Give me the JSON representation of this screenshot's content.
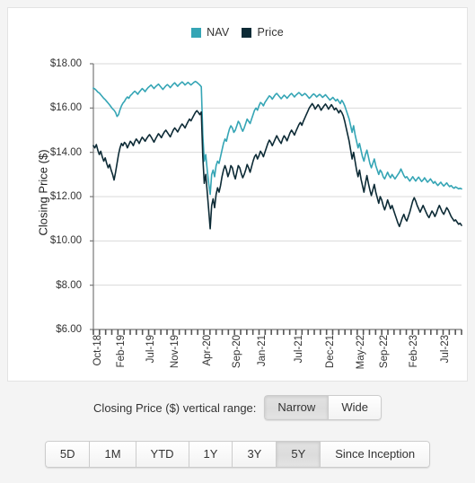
{
  "legend": {
    "entries": [
      {
        "label": "NAV",
        "color": "#35a5b5"
      },
      {
        "label": "Price",
        "color": "#0d2b36"
      }
    ]
  },
  "axes": {
    "y_title": "Closing Price ($)",
    "y_ticks": [
      "$18.00",
      "$16.00",
      "$14.00",
      "$12.00",
      "$10.00",
      "$8.00",
      "$6.00"
    ],
    "x_ticks": [
      "Oct-18",
      "Feb-19",
      "Jul-19",
      "Nov-19",
      "Apr-20",
      "Sep-20",
      "Jan-21",
      "Jul-21",
      "Dec-21",
      "May-22",
      "Sep-22",
      "Feb-23",
      "Jul-23"
    ]
  },
  "vertical_range": {
    "label": "Closing Price ($) vertical range:",
    "options": [
      {
        "label": "Narrow",
        "selected": true
      },
      {
        "label": "Wide",
        "selected": false
      }
    ]
  },
  "time_range": {
    "options": [
      {
        "label": "5D",
        "selected": false
      },
      {
        "label": "1M",
        "selected": false
      },
      {
        "label": "YTD",
        "selected": false
      },
      {
        "label": "1Y",
        "selected": false
      },
      {
        "label": "3Y",
        "selected": false
      },
      {
        "label": "5Y",
        "selected": true
      },
      {
        "label": "Since Inception",
        "selected": false
      }
    ]
  },
  "chart_data": {
    "type": "line",
    "title": "",
    "xlabel": "",
    "ylabel": "Closing Price ($)",
    "ylim": [
      6.0,
      18.0
    ],
    "ytick_values": [
      18.0,
      16.0,
      14.0,
      12.0,
      10.0,
      8.0,
      6.0
    ],
    "grid": true,
    "legend_position": "top-center",
    "x_tick_labels": [
      "Oct-18",
      "Feb-19",
      "Jul-19",
      "Nov-19",
      "Apr-20",
      "Sep-20",
      "Jan-21",
      "Jul-21",
      "Dec-21",
      "May-22",
      "Sep-22",
      "Feb-23",
      "Jul-23"
    ],
    "x_tick_indices": [
      0,
      16,
      36,
      52,
      74,
      94,
      111,
      136,
      157,
      178,
      194,
      214,
      235
    ],
    "x_range_labels": [
      "Oct-2018",
      "Sep-2023"
    ],
    "n_points": 250,
    "series": [
      {
        "name": "NAV",
        "color": "#35a5b5",
        "values": [
          16.9,
          16.86,
          16.8,
          16.72,
          16.68,
          16.6,
          16.52,
          16.44,
          16.38,
          16.3,
          16.22,
          16.14,
          16.05,
          15.96,
          15.9,
          15.8,
          15.62,
          15.7,
          15.92,
          16.1,
          16.22,
          16.3,
          16.42,
          16.5,
          16.44,
          16.56,
          16.62,
          16.7,
          16.76,
          16.7,
          16.62,
          16.72,
          16.8,
          16.88,
          16.82,
          16.74,
          16.84,
          16.92,
          16.98,
          17.04,
          16.96,
          16.88,
          16.96,
          17.02,
          17.08,
          17.0,
          16.92,
          16.84,
          16.92,
          17.0,
          17.06,
          17.0,
          16.92,
          17.0,
          17.08,
          17.14,
          17.06,
          16.98,
          17.06,
          17.12,
          17.18,
          17.12,
          17.04,
          17.1,
          17.16,
          17.1,
          17.04,
          17.1,
          17.16,
          17.2,
          17.16,
          17.1,
          17.04,
          16.96,
          14.8,
          13.6,
          13.9,
          13.2,
          12.6,
          12.1,
          13.0,
          13.2,
          12.9,
          13.4,
          13.6,
          13.5,
          13.8,
          14.1,
          14.4,
          14.6,
          14.5,
          14.8,
          15.05,
          15.2,
          15.1,
          14.9,
          15.0,
          15.2,
          15.4,
          15.3,
          15.1,
          14.95,
          15.1,
          15.3,
          15.5,
          15.4,
          15.3,
          15.5,
          15.7,
          15.9,
          16.0,
          15.9,
          16.1,
          16.25,
          16.2,
          16.1,
          16.25,
          16.35,
          16.45,
          16.55,
          16.5,
          16.4,
          16.5,
          16.6,
          16.66,
          16.58,
          16.5,
          16.42,
          16.5,
          16.58,
          16.52,
          16.44,
          16.52,
          16.6,
          16.66,
          16.58,
          16.5,
          16.58,
          16.64,
          16.7,
          16.64,
          16.56,
          16.6,
          16.66,
          16.6,
          16.52,
          16.44,
          16.5,
          16.58,
          16.64,
          16.58,
          16.5,
          16.56,
          16.62,
          16.56,
          16.48,
          16.54,
          16.6,
          16.52,
          16.44,
          16.36,
          16.42,
          16.48,
          16.4,
          16.32,
          16.4,
          16.3,
          16.2,
          16.35,
          16.25,
          16.1,
          15.9,
          15.7,
          15.5,
          15.2,
          14.9,
          15.2,
          14.8,
          14.5,
          14.2,
          14.4,
          14.1,
          13.8,
          13.6,
          13.9,
          14.1,
          13.8,
          13.5,
          13.3,
          13.5,
          13.7,
          13.4,
          13.2,
          13.0,
          13.2,
          13.1,
          12.9,
          12.8,
          12.95,
          13.1,
          12.95,
          12.85,
          13.0,
          12.9,
          12.8,
          12.9,
          13.0,
          13.1,
          13.25,
          13.1,
          12.95,
          12.85,
          12.9,
          12.8,
          12.7,
          12.8,
          12.9,
          12.8,
          12.7,
          12.8,
          12.88,
          12.78,
          12.68,
          12.75,
          12.85,
          12.75,
          12.65,
          12.72,
          12.8,
          12.7,
          12.6,
          12.68,
          12.58,
          12.5,
          12.58,
          12.65,
          12.55,
          12.48,
          12.55,
          12.62,
          12.52,
          12.45,
          12.5,
          12.42,
          12.38,
          12.44,
          12.4,
          12.35,
          12.38,
          12.35
        ]
      },
      {
        "name": "Price",
        "color": "#0d2b36",
        "values": [
          14.3,
          14.2,
          14.35,
          14.1,
          13.9,
          14.05,
          13.8,
          13.6,
          13.75,
          13.5,
          13.3,
          13.45,
          13.2,
          13.0,
          12.75,
          13.1,
          13.5,
          13.9,
          14.2,
          14.4,
          14.3,
          14.45,
          14.38,
          14.2,
          14.35,
          14.5,
          14.42,
          14.3,
          14.48,
          14.6,
          14.52,
          14.4,
          14.55,
          14.68,
          14.6,
          14.5,
          14.62,
          14.72,
          14.8,
          14.7,
          14.58,
          14.46,
          14.6,
          14.72,
          14.84,
          14.76,
          14.66,
          14.8,
          14.92,
          15.0,
          14.9,
          14.8,
          14.7,
          14.85,
          15.0,
          15.1,
          15.02,
          14.92,
          15.05,
          15.18,
          15.28,
          15.2,
          15.1,
          15.25,
          15.38,
          15.5,
          15.42,
          15.55,
          15.68,
          15.8,
          15.88,
          15.8,
          15.7,
          15.82,
          13.8,
          12.6,
          13.0,
          12.2,
          11.4,
          10.55,
          11.6,
          11.9,
          11.5,
          12.1,
          12.4,
          12.2,
          12.5,
          12.9,
          13.2,
          13.4,
          13.2,
          12.9,
          13.1,
          13.4,
          13.3,
          13.0,
          12.8,
          13.1,
          13.4,
          13.3,
          13.05,
          12.85,
          13.0,
          13.2,
          13.45,
          13.3,
          13.1,
          13.35,
          13.6,
          13.8,
          13.9,
          13.7,
          13.85,
          14.05,
          13.95,
          13.8,
          14.0,
          14.2,
          14.4,
          14.55,
          14.45,
          14.3,
          14.45,
          14.6,
          14.75,
          14.62,
          14.5,
          14.4,
          14.6,
          14.75,
          14.65,
          14.52,
          14.7,
          14.88,
          15.0,
          14.9,
          14.78,
          14.95,
          15.1,
          15.25,
          15.35,
          15.22,
          15.4,
          15.55,
          15.7,
          15.85,
          16.0,
          16.1,
          16.2,
          16.1,
          15.95,
          16.05,
          16.15,
          16.05,
          15.9,
          16.0,
          16.1,
          16.18,
          16.08,
          15.95,
          16.05,
          16.15,
          16.05,
          15.92,
          16.0,
          15.9,
          15.78,
          15.9,
          15.8,
          15.65,
          15.4,
          15.1,
          14.8,
          14.5,
          14.1,
          13.7,
          14.0,
          13.6,
          13.2,
          12.9,
          13.2,
          12.8,
          12.5,
          12.2,
          12.6,
          12.95,
          12.6,
          12.3,
          12.05,
          12.3,
          12.55,
          12.2,
          11.95,
          11.7,
          12.0,
          11.85,
          11.6,
          11.4,
          11.6,
          11.85,
          11.65,
          11.45,
          11.6,
          11.4,
          11.2,
          11.0,
          10.8,
          10.65,
          10.85,
          11.05,
          11.2,
          11.0,
          10.9,
          11.1,
          11.3,
          11.55,
          11.8,
          11.95,
          11.8,
          11.6,
          11.45,
          11.3,
          11.45,
          11.6,
          11.45,
          11.3,
          11.15,
          11.05,
          11.2,
          11.35,
          11.25,
          11.1,
          11.25,
          11.45,
          11.6,
          11.45,
          11.3,
          11.2,
          11.35,
          11.5,
          11.4,
          11.25,
          11.1,
          11.0,
          10.9,
          10.95,
          10.85,
          10.75,
          10.8,
          10.7
        ]
      }
    ]
  }
}
